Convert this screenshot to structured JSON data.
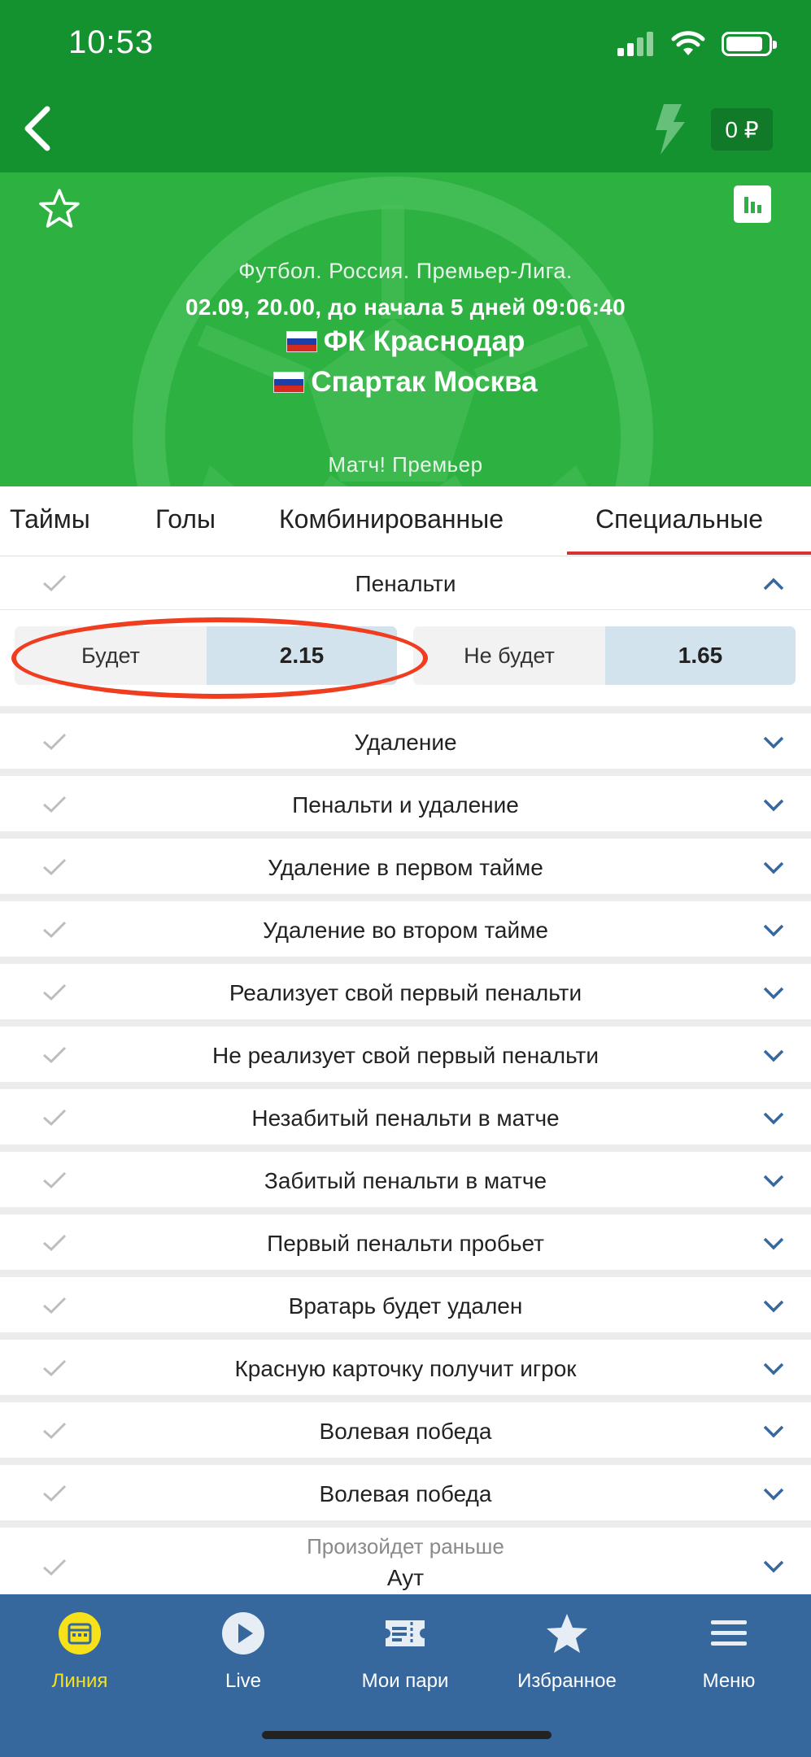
{
  "status": {
    "time": "10:53"
  },
  "header": {
    "balance": "0 ₽"
  },
  "match": {
    "sport": "Футбол. Россия. Премьер-Лига.",
    "datetime": "02.09, 20.00,  до начала 5 дней 09:06:40",
    "team1": "ФК Краснодар",
    "team2": "Спартак Москва",
    "channel": "Матч! Премьер"
  },
  "tabs": [
    "Таймы",
    "Голы",
    "Комбинированные",
    "Специальные"
  ],
  "active_tab": "Специальные",
  "expanded_market": {
    "title": "Пенальти",
    "outcomes": [
      {
        "label": "Будет",
        "odds": "2.15"
      },
      {
        "label": "Не будет",
        "odds": "1.65"
      }
    ]
  },
  "markets": [
    "Удаление",
    "Пенальти и удаление",
    "Удаление в первом тайме",
    "Удаление во втором тайме",
    "Реализует свой первый пенальти",
    "Не реализует свой первый пенальти",
    "Незабитый пенальти в матче",
    "Забитый пенальти в матче",
    "Первый пенальти пробьет",
    "Вратарь будет удален",
    "Красную карточку получит игрок",
    "Волевая победа",
    "Волевая победа"
  ],
  "last_market": {
    "subtitle": "Произойдет раньше",
    "title": "Аут"
  },
  "bottom_nav": [
    {
      "label": "Линия",
      "icon": "calendar-icon",
      "active": true
    },
    {
      "label": "Live",
      "icon": "play-icon",
      "active": false
    },
    {
      "label": "Мои пари",
      "icon": "ticket-icon",
      "active": false
    },
    {
      "label": "Избранное",
      "icon": "star-icon",
      "active": false
    },
    {
      "label": "Меню",
      "icon": "menu-icon",
      "active": false
    }
  ],
  "colors": {
    "header_green": "#14922f",
    "hero_green": "#2db141",
    "tab_underline": "#d63330",
    "nav_blue": "#36689e",
    "nav_active": "#f7e11b",
    "highlight_ring": "#f03d1f"
  }
}
